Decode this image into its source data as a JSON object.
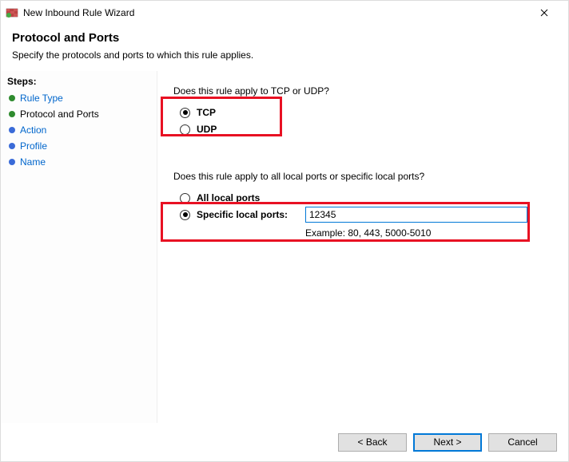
{
  "window": {
    "title": "New Inbound Rule Wizard"
  },
  "header": {
    "title": "Protocol and Ports",
    "subtitle": "Specify the protocols and ports to which this rule applies."
  },
  "sidebar": {
    "steps_label": "Steps:",
    "items": [
      {
        "label": "Rule Type",
        "state": "done",
        "link": true
      },
      {
        "label": "Protocol and Ports",
        "state": "current",
        "link": false
      },
      {
        "label": "Action",
        "state": "pending",
        "link": true
      },
      {
        "label": "Profile",
        "state": "pending",
        "link": true
      },
      {
        "label": "Name",
        "state": "pending",
        "link": true
      }
    ]
  },
  "content": {
    "protocol_question": "Does this rule apply to TCP or UDP?",
    "tcp_label": "TCP",
    "udp_label": "UDP",
    "ports_question": "Does this rule apply to all local ports or specific local ports?",
    "all_ports_label": "All local ports",
    "specific_ports_label": "Specific local ports:",
    "port_value": "12345",
    "example_text": "Example: 80, 443, 5000-5010"
  },
  "footer": {
    "back": "< Back",
    "next": "Next >",
    "cancel": "Cancel"
  }
}
